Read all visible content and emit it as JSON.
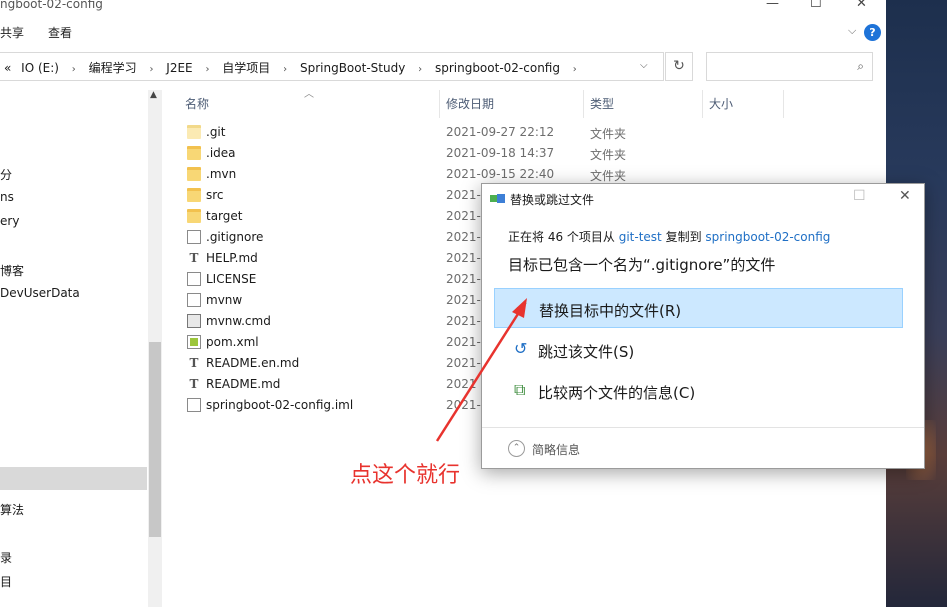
{
  "window": {
    "title": "ngboot-02-config",
    "minimize": "—",
    "maximize": "☐",
    "close": "✕"
  },
  "menu": [
    "共享",
    "查看"
  ],
  "address": {
    "prefix": "«",
    "crumbs": [
      "IO (E:)",
      "编程学习",
      "J2EE",
      "自学项目",
      "SpringBoot-Study",
      "springboot-02-config"
    ],
    "separator": "›",
    "dropdown": "⌵",
    "refresh_icon": "↻",
    "search_placeholder": ""
  },
  "nav_items": [
    "分",
    "ns",
    "ery",
    "博客",
    "DevUserData",
    "算法",
    "录",
    "目"
  ],
  "columns": [
    "名称",
    "修改日期",
    "类型",
    "大小"
  ],
  "files": [
    {
      "name": ".git",
      "date": "2021-09-27 22:12",
      "type": "文件夹",
      "icon": "folder-light-icon"
    },
    {
      "name": ".idea",
      "date": "2021-09-18 14:37",
      "type": "文件夹",
      "icon": "folder-icon"
    },
    {
      "name": ".mvn",
      "date": "2021-09-15 22:40",
      "type": "文件夹",
      "icon": "folder-icon"
    },
    {
      "name": "src",
      "date": "2021-",
      "type": "",
      "icon": "folder-icon"
    },
    {
      "name": "target",
      "date": "2021-",
      "type": "",
      "icon": "folder-icon"
    },
    {
      "name": ".gitignore",
      "date": "2021-",
      "type": "",
      "icon": "file-icon"
    },
    {
      "name": "HELP.md",
      "date": "2021-",
      "type": "",
      "icon": "text-file-icon"
    },
    {
      "name": "LICENSE",
      "date": "2021-",
      "type": "",
      "icon": "file-icon"
    },
    {
      "name": "mvnw",
      "date": "2021-",
      "type": "",
      "icon": "file-icon"
    },
    {
      "name": "mvnw.cmd",
      "date": "2021-",
      "type": "",
      "icon": "cmd-file-icon"
    },
    {
      "name": "pom.xml",
      "date": "2021-",
      "type": "",
      "icon": "xml-file-icon"
    },
    {
      "name": "README.en.md",
      "date": "2021-",
      "type": "",
      "icon": "text-file-icon"
    },
    {
      "name": "README.md",
      "date": "2021",
      "type": "",
      "icon": "text-file-icon"
    },
    {
      "name": "springboot-02-config.iml",
      "date": "2021-",
      "type": "",
      "icon": "file-icon"
    }
  ],
  "dialog": {
    "title": "替换或跳过文件",
    "status_prefix": "正在将 46 个项目从 ",
    "source": "git-test",
    "status_mid": " 复制到 ",
    "destination": "springboot-02-config",
    "heading": "目标已包含一个名为“.gitignore”的文件",
    "options": [
      {
        "label": "替换目标中的文件(R)",
        "icon": "checkmark-icon",
        "glyph": "✔",
        "color": "#2e9e3e"
      },
      {
        "label": "跳过该文件(S)",
        "icon": "skip-icon",
        "glyph": "↺",
        "color": "#1f6fc5"
      },
      {
        "label": "比较两个文件的信息(C)",
        "icon": "compare-icon",
        "glyph": "⧉",
        "color": "#3a8a3a"
      }
    ],
    "more_label": "简略信息",
    "more_icon": "⌃"
  },
  "annotation": {
    "text": "点这个就行",
    "color": "#e8332e"
  }
}
